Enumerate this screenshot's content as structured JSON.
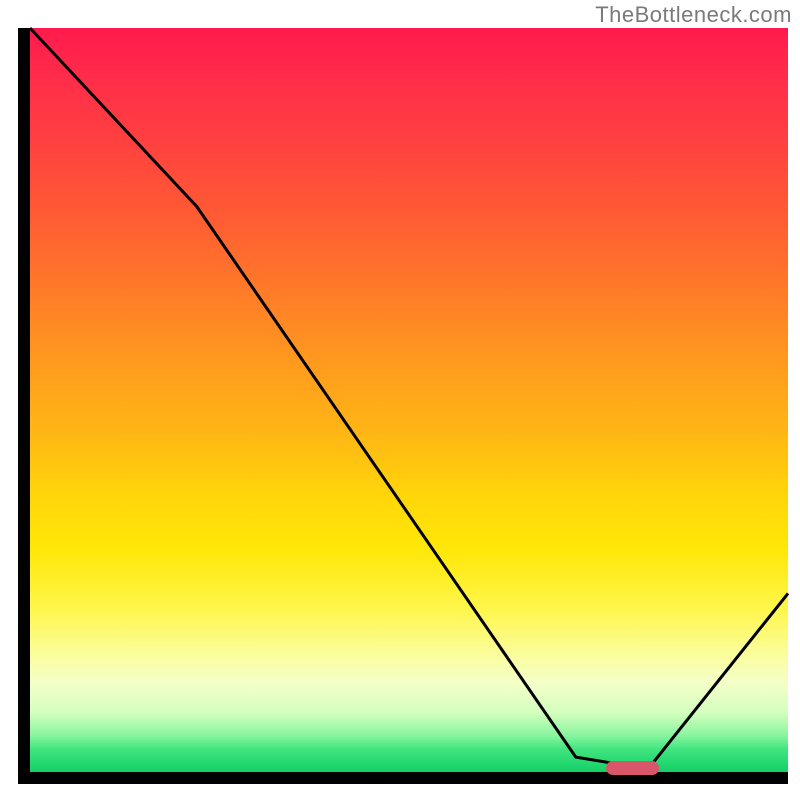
{
  "attribution": "TheBottleneck.com",
  "chart_data": {
    "type": "line",
    "title": "",
    "xlabel": "",
    "ylabel": "",
    "xlim": [
      0,
      100
    ],
    "ylim": [
      0,
      100
    ],
    "grid": false,
    "series": [
      {
        "name": "bottleneck-curve",
        "x": [
          0,
          22,
          72,
          78,
          82,
          100
        ],
        "y": [
          100,
          76,
          2,
          1,
          1,
          24
        ]
      }
    ],
    "annotations": [
      {
        "name": "optimal-marker",
        "x_range": [
          76,
          83
        ],
        "y": 0.5,
        "shape": "rounded-bar",
        "color": "#d9566a"
      }
    ],
    "background_gradient": {
      "orientation": "vertical",
      "stops": [
        {
          "pct": 0,
          "color": "#ff1a4d"
        },
        {
          "pct": 50,
          "color": "#ffb000"
        },
        {
          "pct": 75,
          "color": "#fff000"
        },
        {
          "pct": 100,
          "color": "#14cf66"
        }
      ]
    }
  }
}
